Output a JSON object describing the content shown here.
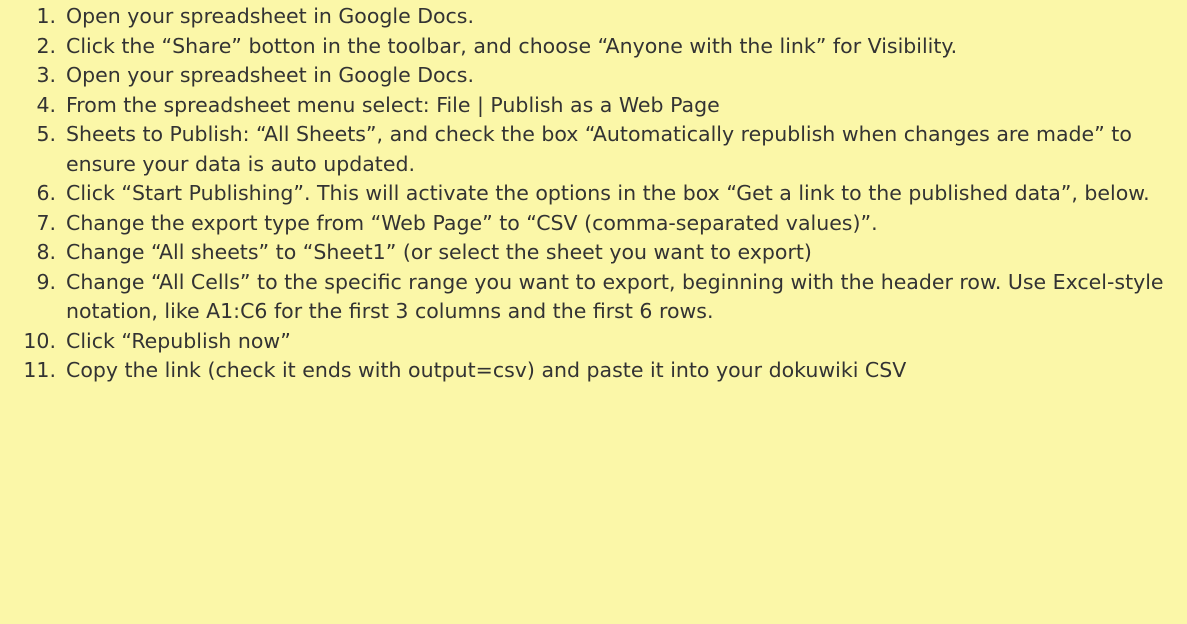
{
  "background_color": "#fbf7a8",
  "text_color": "#333333",
  "steps": [
    {
      "number": "1.",
      "text": "Open your spreadsheet in Google Docs."
    },
    {
      "number": "2.",
      "text": "Click the “Share” botton in the toolbar, and choose “Anyone with the link” for Visibility."
    },
    {
      "number": "3.",
      "text": "Open your spreadsheet in Google Docs."
    },
    {
      "number": "4.",
      "text": "From the spreadsheet menu select: File | Publish as a Web Page"
    },
    {
      "number": "5.",
      "text": "Sheets to Publish: “All Sheets”, and check the box “Automatically republish when changes are made” to ensure your data is auto updated."
    },
    {
      "number": "6.",
      "text": "Click “Start Publishing”. This will activate the options in the box “Get a link to the published data”, below."
    },
    {
      "number": "7.",
      "text": "Change the export type from “Web Page” to “CSV (comma-separated values)”."
    },
    {
      "number": "8.",
      "text": "Change “All sheets” to “Sheet1” (or select the sheet you want to export)"
    },
    {
      "number": "9.",
      "text": "Change “All Cells” to the specific range you want to export, beginning with the header row. Use Excel-style notation, like A1:C6 for the first 3 columns and the first 6 rows."
    },
    {
      "number": "10.",
      "text": "Click “Republish now”"
    },
    {
      "number": "11.",
      "text": "Copy the link (check it ends with output=csv) and paste it into your dokuwiki CSV"
    }
  ]
}
